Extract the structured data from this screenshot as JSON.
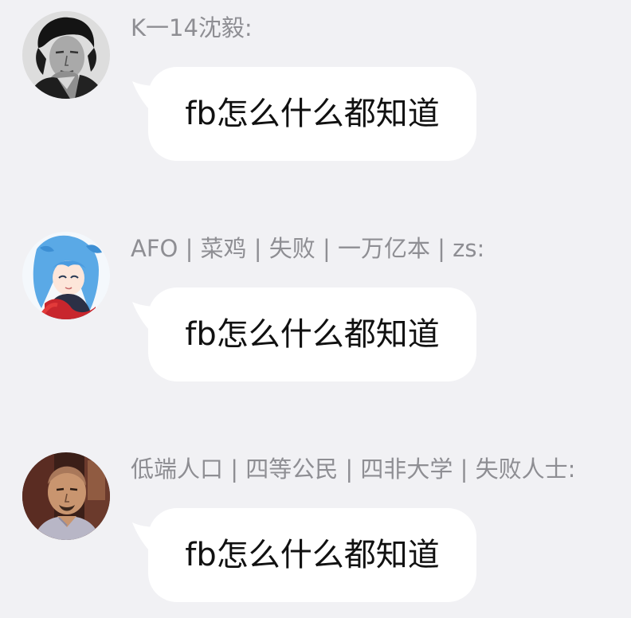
{
  "messages": [
    {
      "sender": "K一14沈毅:",
      "text": "fb怎么什么都知道",
      "avatar_icon": "portrait-avatar-icon"
    },
    {
      "sender": "AFO | 菜鸡 | 失败 | 一万亿本 | zs:",
      "text": "fb怎么什么都知道",
      "avatar_icon": "anime-girl-avatar-icon"
    },
    {
      "sender": "低端人口 | 四等公民 | 四非大学 | 失败人士:",
      "text": "fb怎么什么都知道",
      "avatar_icon": "bald-man-avatar-icon"
    }
  ],
  "colors": {
    "background": "#f1f1f4",
    "bubble": "#ffffff",
    "sender_text": "#8e8e93",
    "message_text": "#111111"
  }
}
